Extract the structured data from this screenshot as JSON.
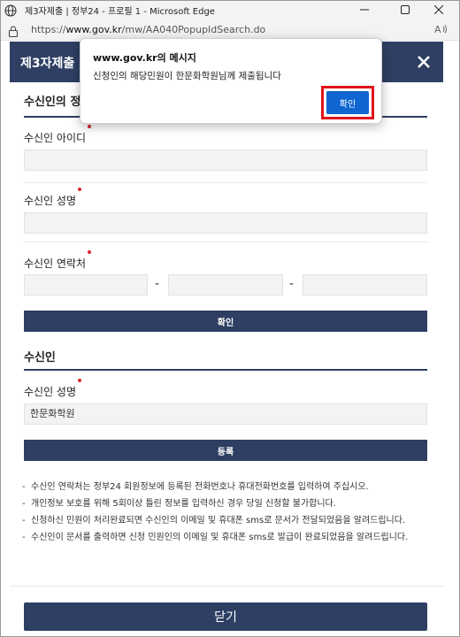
{
  "window": {
    "title": "제3자제출 | 정부24 - 프로필 1 - Microsoft Edge"
  },
  "address_bar": {
    "url_prefix": "https://",
    "url_host": "www.gov.kr",
    "url_path": "/mw/AA040PopupIdSearch.do"
  },
  "page": {
    "header_title": "제3자제출",
    "section1": {
      "title": "수신인의 정보",
      "fields": {
        "id_label": "수신인 아이디",
        "id_value": "",
        "name_label": "수신인 성명",
        "name_value": "",
        "phone_label": "수신인 연락처",
        "phone_part1": "",
        "phone_part2": "",
        "phone_part3": "",
        "phone_dash": "-"
      },
      "confirm_label": "확인"
    },
    "section2": {
      "title": "수신인",
      "name_label": "수신인 성명",
      "name_value": "한문화학원",
      "register_label": "등록"
    },
    "notes": [
      "수신인 연락처는 정부24 회원정보에 등록된 전화번호나 휴대전화번호를 입력하여 주십시오.",
      "개인정보 보호를 위해 5회이상 틀린 정보를 입력하신 경우 당일 신청할 불가합니다.",
      "신청하신 민원이 처리완료되면 수신인의 이메일 및 휴대폰 sms로 문서가 전달되었음을 알려드립니다.",
      "수신인이 문서를 출력하면 신청 민원인의 이메일 및 휴대폰 sms로 발급이 완료되었음을 알려드립니다."
    ],
    "close_button_label": "닫기"
  },
  "dialog": {
    "title": "www.gov.kr의 메시지",
    "message": "신청인의 해당민원이 한문화학원님께 제출됩니다",
    "ok_label": "확인"
  },
  "colors": {
    "navy": "#2e3f63",
    "accent_blue": "#1066d0",
    "highlight_red": "#e0131a",
    "required_red": "#d7262e"
  },
  "icons": [
    "globe-icon",
    "minimize-icon",
    "maximize-icon",
    "window-close-icon",
    "lock-icon",
    "read-aloud-icon",
    "close-icon"
  ]
}
